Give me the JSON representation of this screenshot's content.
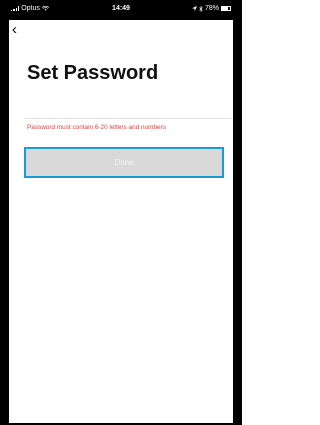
{
  "status_bar": {
    "carrier": "Optus",
    "time": "14:49",
    "location_icon": "location-arrow-icon",
    "bluetooth_icon": "bluetooth-icon",
    "battery_percent": "78%"
  },
  "nav": {
    "back_icon": "chevron-left-icon"
  },
  "page": {
    "title": "Set Password",
    "error_message": "Password must contain 6-20 letters and numbers"
  },
  "actions": {
    "done_label": "Done",
    "done_enabled": false
  },
  "colors": {
    "error": "#e5413a",
    "focus_border": "#1b9ad6",
    "button_disabled_bg": "#d9d9d9"
  }
}
